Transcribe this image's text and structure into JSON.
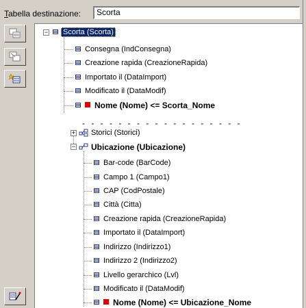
{
  "header": {
    "label_mnemonic": "T",
    "label_rest": "abella destinazione:",
    "table_value": "Scorta"
  },
  "toolbar": {
    "icons": [
      "duplicate-table-icon",
      "remove-table-icon",
      "new-field-icon",
      "edit-wizard-icon"
    ]
  },
  "tree": {
    "root": {
      "label": "Scorta (Scorta)",
      "expander": "−"
    },
    "fields": [
      "Consegna (IndConsegna)",
      "Creazione rapida (CreazioneRapida)",
      "Importato il (DataImport)",
      "Modificato il (DataModif)"
    ],
    "key_field": "Nome (Nome)  <=  Scorta_Nome",
    "separator": "- - - - - - - - - - - - - - - - - -",
    "link1": {
      "label": "Storici (Storici)",
      "expander": "+"
    },
    "link2": {
      "label": "Ubicazione (Ubicazione)",
      "expander": "−"
    },
    "sub_fields": [
      "Bar-code (BarCode)",
      "Campo 1 (Campo1)",
      "CAP (CodPostale)",
      "Città (Citta)",
      "Creazione rapida (CreazioneRapida)",
      "Importato il (DataImport)",
      "Indirizzo (Indirizzo1)",
      "Indirizzo 2 (Indirizzo2)",
      "Livello gerarchico (Lvl)",
      "Modificato il (DataModif)"
    ],
    "sub_key_field": "Nome (Nome)  <=  Ubicazione_Nome"
  }
}
